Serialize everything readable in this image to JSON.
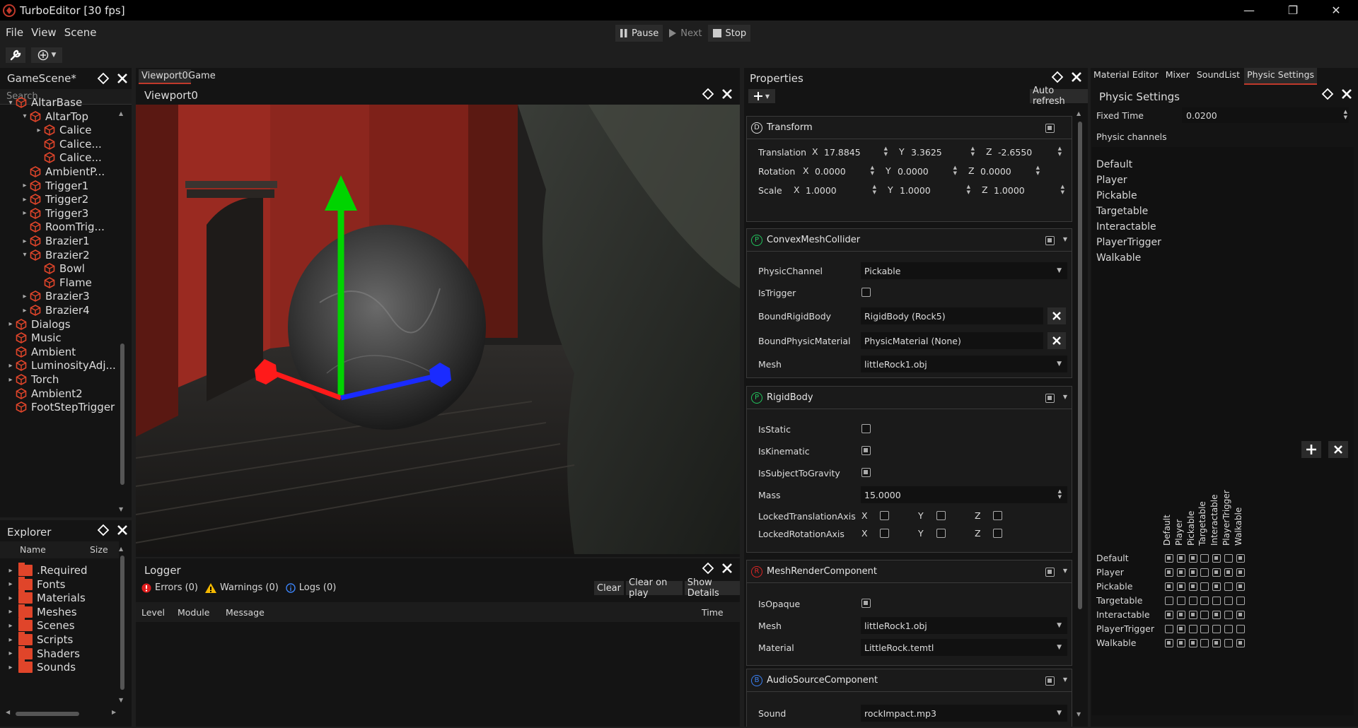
{
  "window": {
    "title": "TurboEditor [30 fps]",
    "minimize": "—",
    "maximize": "❐",
    "close": "✕"
  },
  "menu": [
    "File",
    "View",
    "Scene"
  ],
  "play": {
    "pause": "Pause",
    "next": "Next",
    "stop": "Stop"
  },
  "scene_panel": {
    "title": "GameScene*",
    "search_placeholder": "Search",
    "items": [
      {
        "label": "AltarBase",
        "level": 0,
        "arrow": "▾"
      },
      {
        "label": "AltarTop",
        "level": 1,
        "arrow": "▾"
      },
      {
        "label": "Calice",
        "level": 2,
        "arrow": "▸"
      },
      {
        "label": "Calice...",
        "level": 2,
        "arrow": ""
      },
      {
        "label": "Calice...",
        "level": 2,
        "arrow": ""
      },
      {
        "label": "AmbientP...",
        "level": 1,
        "arrow": ""
      },
      {
        "label": "Trigger1",
        "level": 1,
        "arrow": "▸"
      },
      {
        "label": "Trigger2",
        "level": 1,
        "arrow": "▸"
      },
      {
        "label": "Trigger3",
        "level": 1,
        "arrow": "▸"
      },
      {
        "label": "RoomTrig...",
        "level": 1,
        "arrow": ""
      },
      {
        "label": "Brazier1",
        "level": 1,
        "arrow": "▸"
      },
      {
        "label": "Brazier2",
        "level": 1,
        "arrow": "▾"
      },
      {
        "label": "Bowl",
        "level": 2,
        "arrow": ""
      },
      {
        "label": "Flame",
        "level": 2,
        "arrow": ""
      },
      {
        "label": "Brazier3",
        "level": 1,
        "arrow": "▸"
      },
      {
        "label": "Brazier4",
        "level": 1,
        "arrow": "▸"
      },
      {
        "label": "Dialogs",
        "level": 0,
        "arrow": "▸"
      },
      {
        "label": "Music",
        "level": 0,
        "arrow": ""
      },
      {
        "label": "Ambient",
        "level": 0,
        "arrow": ""
      },
      {
        "label": "LuminosityAdj...",
        "level": 0,
        "arrow": "▸"
      },
      {
        "label": "Torch",
        "level": 0,
        "arrow": "▸"
      },
      {
        "label": "Ambient2",
        "level": 0,
        "arrow": ""
      },
      {
        "label": "FootStepTrigger",
        "level": 0,
        "arrow": ""
      }
    ]
  },
  "explorer": {
    "title": "Explorer",
    "columns": {
      "name": "Name",
      "size": "Size"
    },
    "folders": [
      ".Required",
      "Fonts",
      "Materials",
      "Meshes",
      "Scenes",
      "Scripts",
      "Shaders",
      "Sounds"
    ]
  },
  "viewport": {
    "tabs": [
      "Viewport0",
      "Game"
    ],
    "title": "Viewport0"
  },
  "logger": {
    "title": "Logger",
    "errors": "Errors (0)",
    "warnings": "Warnings (0)",
    "logs": "Logs (0)",
    "clear": "Clear",
    "clear_on_play": "Clear on play",
    "show_details": "Show Details",
    "columns": [
      "Level",
      "Module",
      "Message",
      "Time"
    ]
  },
  "properties": {
    "title": "Properties",
    "auto_refresh": "Auto refresh",
    "transform": {
      "title": "Transform",
      "rows": [
        {
          "label": "Translation",
          "x": "17.8845",
          "y": "3.3625",
          "z": "-2.6550"
        },
        {
          "label": "Rotation",
          "x": "0.0000",
          "y": "0.0000",
          "z": "0.0000"
        },
        {
          "label": "Scale",
          "x": "1.0000",
          "y": "1.0000",
          "z": "1.0000"
        }
      ]
    },
    "convex": {
      "title": "ConvexMeshCollider",
      "physic_channel_label": "PhysicChannel",
      "physic_channel": "Pickable",
      "is_trigger_label": "IsTrigger",
      "bound_rb_label": "BoundRigidBody",
      "bound_rb": "RigidBody (Rock5)",
      "bound_pm_label": "BoundPhysicMaterial",
      "bound_pm": "PhysicMaterial (None)",
      "mesh_label": "Mesh",
      "mesh": "littleRock1.obj"
    },
    "rigidbody": {
      "title": "RigidBody",
      "is_static": "IsStatic",
      "is_kinematic": "IsKinematic",
      "gravity": "IsSubjectToGravity",
      "mass_label": "Mass",
      "mass": "15.0000",
      "locked_t": "LockedTranslationAxis",
      "locked_r": "LockedRotationAxis",
      "x": "X",
      "y": "Y",
      "z": "Z"
    },
    "meshrender": {
      "title": "MeshRenderComponent",
      "is_opaque": "IsOpaque",
      "mesh_label": "Mesh",
      "mesh": "littleRock1.obj",
      "material_label": "Material",
      "material": "LittleRock.temtl"
    },
    "audio": {
      "title": "AudioSourceComponent",
      "sound_label": "Sound",
      "sound": "rockImpact.mp3"
    }
  },
  "right_tabs": [
    "Material Editor",
    "Mixer",
    "SoundList",
    "Physic Settings"
  ],
  "physic": {
    "title": "Physic Settings",
    "fixed_time_label": "Fixed Time",
    "fixed_time": "0.0200",
    "channels_label": "Physic channels",
    "channels": [
      "Default",
      "Player",
      "Pickable",
      "Targetable",
      "Interactable",
      "PlayerTrigger",
      "Walkable"
    ],
    "matrix": [
      [
        1,
        1,
        1,
        0,
        1,
        0,
        1
      ],
      [
        1,
        1,
        1,
        0,
        1,
        1,
        1
      ],
      [
        1,
        1,
        1,
        0,
        1,
        0,
        1
      ],
      [
        0,
        0,
        0,
        0,
        0,
        0,
        0
      ],
      [
        1,
        1,
        1,
        0,
        1,
        0,
        1
      ],
      [
        0,
        1,
        0,
        0,
        0,
        0,
        0
      ],
      [
        1,
        1,
        1,
        0,
        1,
        0,
        1
      ]
    ]
  },
  "colors": {
    "accent": "#c0392b",
    "gizmo_y": "#00d400",
    "gizmo_x": "#ff1a1a",
    "gizmo_z": "#1a2bff"
  }
}
